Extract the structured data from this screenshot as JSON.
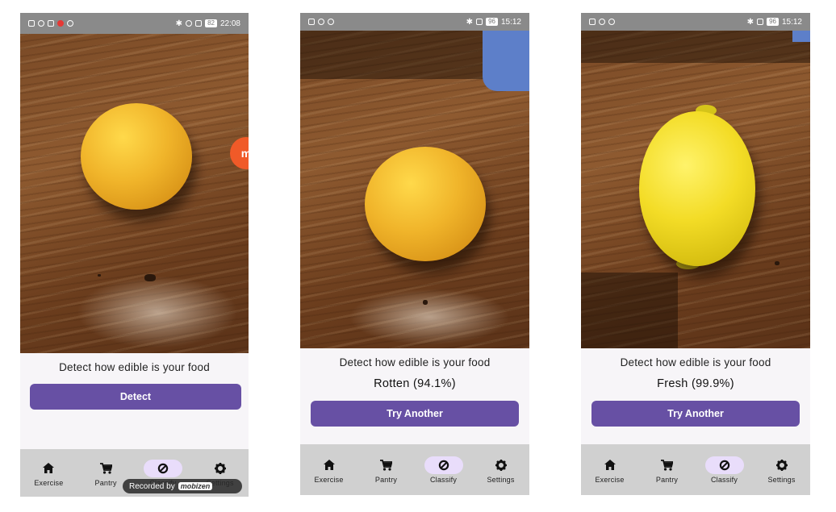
{
  "screens": [
    {
      "status": {
        "time": "22:08",
        "battery": "82"
      },
      "caption": "Detect how edible is your food",
      "result": "",
      "button_label": "Detect",
      "active_tab": "classify"
    },
    {
      "status": {
        "time": "15:12",
        "battery": "96"
      },
      "caption": "Detect how edible is your food",
      "result": "Rotten (94.1%)",
      "button_label": "Try Another",
      "active_tab": "classify"
    },
    {
      "status": {
        "time": "15:12",
        "battery": "96"
      },
      "caption": "Detect how edible is your food",
      "result": "Fresh (99.9%)",
      "button_label": "Try Another",
      "active_tab": "classify"
    }
  ],
  "nav": {
    "items": [
      {
        "label": "Exercise",
        "icon": "home-icon"
      },
      {
        "label": "Pantry",
        "icon": "cart-icon"
      },
      {
        "label": "Classify",
        "icon": "classify-icon"
      },
      {
        "label": "Settings",
        "icon": "gear-icon"
      }
    ]
  },
  "overlay": {
    "recorded_text": "Recorded by",
    "recorder_brand": "mobizen"
  },
  "colors": {
    "accent": "#6750a4",
    "nav_bg": "#d0d0d0",
    "active_pill": "#e9ddfb",
    "status_bar": "#8a8a8a"
  }
}
